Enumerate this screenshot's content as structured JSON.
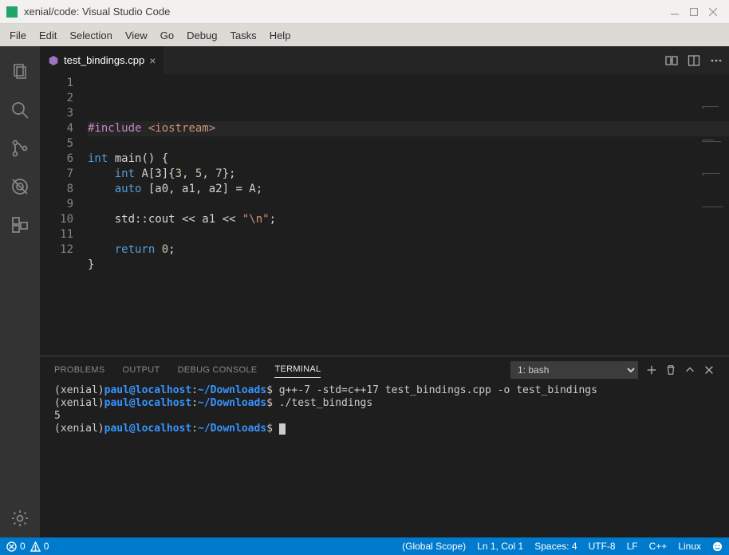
{
  "os_title": "xenial/code: Visual Studio Code",
  "menu": [
    "File",
    "Edit",
    "Selection",
    "View",
    "Go",
    "Debug",
    "Tasks",
    "Help"
  ],
  "tab": {
    "filename": "test_bindings.cpp"
  },
  "code_lines": [
    {
      "n": 1,
      "html": "<span class='tok-include'>#include</span> <span class='tok-string'>&lt;iostream&gt;</span>",
      "hl": true
    },
    {
      "n": 2,
      "html": ""
    },
    {
      "n": 3,
      "html": "<span class='tok-type'>int</span> main() {"
    },
    {
      "n": 4,
      "html": "    <span class='tok-type'>int</span> A[3]{<span class='tok-number'>3</span>, <span class='tok-number'>5</span>, <span class='tok-number'>7</span>};"
    },
    {
      "n": 5,
      "html": "    <span class='tok-type'>auto</span> [a0, a1, a2] = A;"
    },
    {
      "n": 6,
      "html": ""
    },
    {
      "n": 7,
      "html": "    std::cout &lt;&lt; a1 &lt;&lt; <span class='tok-string'>\"\\n\"</span>;"
    },
    {
      "n": 8,
      "html": ""
    },
    {
      "n": 9,
      "html": "    <span class='tok-keyword'>return</span> <span class='tok-number'>0</span>;"
    },
    {
      "n": 10,
      "html": "}"
    },
    {
      "n": 11,
      "html": ""
    },
    {
      "n": 12,
      "html": ""
    }
  ],
  "panel_tabs": {
    "problems": "PROBLEMS",
    "output": "OUTPUT",
    "debug": "DEBUG CONSOLE",
    "terminal": "TERMINAL"
  },
  "terminal_select": "1: bash",
  "terminal_lines": [
    {
      "env": "xenial",
      "user": "paul@localhost",
      "path": "~/Downloads",
      "cmd": "g++-7 -std=c++17 test_bindings.cpp -o test_bindings"
    },
    {
      "env": "xenial",
      "user": "paul@localhost",
      "path": "~/Downloads",
      "cmd": "./test_bindings"
    },
    {
      "raw": "5"
    },
    {
      "env": "xenial",
      "user": "paul@localhost",
      "path": "~/Downloads",
      "cmd": "",
      "cursor": true
    }
  ],
  "status": {
    "errors": "0",
    "warnings": "0",
    "scope": "(Global Scope)",
    "pos": "Ln 1, Col 1",
    "spaces": "Spaces: 4",
    "encoding": "UTF-8",
    "eol": "LF",
    "lang": "C++",
    "os": "Linux"
  }
}
